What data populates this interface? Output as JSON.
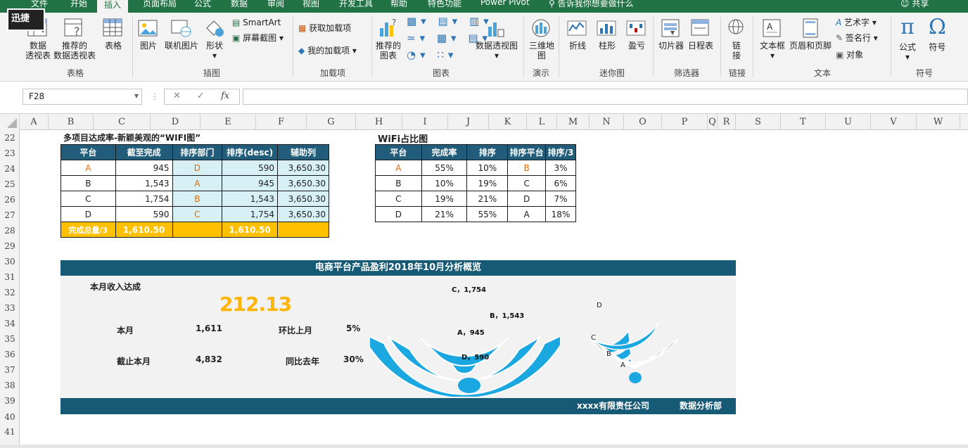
{
  "app": {
    "logo_text": "迅捷",
    "share_label": "共享"
  },
  "tabs": [
    "文件",
    "开始",
    "插入",
    "页面布局",
    "公式",
    "数据",
    "审阅",
    "视图",
    "开发工具",
    "帮助",
    "特色功能",
    "Power Pivot",
    "告诉我你想要做什么"
  ],
  "ribbon": {
    "groups": {
      "tables": {
        "label": "表格",
        "pivot": "数据\n透视表",
        "recommended_pivot": "推荐的\n数据透视表",
        "table": "表格"
      },
      "illustrations": {
        "label": "插图",
        "pictures": "图片",
        "online_pictures": "联机图片",
        "shapes": "形状",
        "smartart": "SmartArt",
        "screenshot": "屏幕截图"
      },
      "addins": {
        "label": "加载项",
        "get_addins": "获取加载项",
        "my_addins": "我的加载项"
      },
      "charts": {
        "label": "图表",
        "recommended": "推荐的\n图表",
        "pivot_chart": "数据透视图"
      },
      "tours": {
        "label": "演示",
        "map3d": "三维地\n图"
      },
      "sparklines": {
        "label": "迷你图",
        "line": "折线",
        "column": "柱形",
        "winloss": "盈亏"
      },
      "filters": {
        "label": "筛选器",
        "slicer": "切片器",
        "timeline": "日程表"
      },
      "links": {
        "label": "链接",
        "link": "链\n接"
      },
      "text": {
        "label": "文本",
        "textbox": "文本框",
        "header_footer": "页眉和页脚",
        "wordart": "艺术字",
        "signature": "签名行",
        "object": "对象"
      },
      "symbols": {
        "label": "符号",
        "equation": "公式",
        "symbol": "符号"
      }
    }
  },
  "formula_bar": {
    "name_box": "F28",
    "fx": "fx",
    "value": ""
  },
  "columns": [
    "A",
    "B",
    "C",
    "D",
    "E",
    "F",
    "G",
    "H",
    "I",
    "J",
    "K",
    "L",
    "M",
    "N",
    "O",
    "P",
    "Q",
    "R",
    "S",
    "T",
    "U",
    "V",
    "W"
  ],
  "rows": [
    "22",
    "23",
    "24",
    "25",
    "26",
    "27",
    "28",
    "29",
    "30",
    "31",
    "32",
    "33",
    "34",
    "35",
    "36",
    "37",
    "38",
    "39",
    "40",
    "41"
  ],
  "table1": {
    "title": "多项目达成率-新颖美观的“WIFI图”",
    "headers": [
      "平台",
      "截至完成",
      "排序部门",
      "排序(desc)",
      "辅助列"
    ],
    "rows": [
      [
        "A",
        "945",
        "D",
        "590",
        "3,650.30"
      ],
      [
        "B",
        "1,543",
        "A",
        "945",
        "3,650.30"
      ],
      [
        "C",
        "1,754",
        "B",
        "1,543",
        "3,650.30"
      ],
      [
        "D",
        "590",
        "C",
        "1,754",
        "3,650.30"
      ]
    ],
    "total": [
      "完成总量/3",
      "1,610.50",
      "",
      "1,610.50",
      ""
    ]
  },
  "table2": {
    "title": "WiFi占比图",
    "headers": [
      "平台",
      "完成率",
      "排序",
      "排序平台",
      "排序/3"
    ],
    "rows": [
      [
        "A",
        "55%",
        "10%",
        "B",
        "3%"
      ],
      [
        "B",
        "10%",
        "19%",
        "C",
        "6%"
      ],
      [
        "C",
        "19%",
        "21%",
        "D",
        "7%"
      ],
      [
        "D",
        "21%",
        "55%",
        "A",
        "18%"
      ]
    ]
  },
  "dashboard": {
    "title": "电商平台产品盈利2018年10月分析概览",
    "income_label": "本月收入达成",
    "big_value": "212.13",
    "month_label": "本月",
    "month_value": "1,611",
    "mom_label": "环比上月",
    "mom_value": "5%",
    "ytd_label": "截止本月",
    "ytd_value": "4,832",
    "yoy_label": "同比去年",
    "yoy_value": "30%",
    "company": "xxxx有限责任公司",
    "department": "数据分析部",
    "accent_color": "#1ba7e0",
    "header_color": "#175a76"
  },
  "chart_data": [
    {
      "type": "radial-bar",
      "name": "wifi-arc-chart",
      "categories": [
        "D",
        "A",
        "B",
        "C"
      ],
      "values": [
        590,
        945,
        1543,
        1754
      ],
      "labels": [
        "D，590",
        "A，945",
        "B，1,543",
        "C，1,754"
      ],
      "color": "#1ba7e0"
    },
    {
      "type": "radial-bar",
      "name": "wifi-share-chart",
      "categories": [
        "A",
        "B",
        "C",
        "D"
      ],
      "values": [
        0.03,
        0.06,
        0.07,
        0.18
      ],
      "labels": [
        "A",
        "B",
        "C",
        "D"
      ],
      "color": "#1ba7e0",
      "track_color": "#d9d9d9"
    }
  ]
}
